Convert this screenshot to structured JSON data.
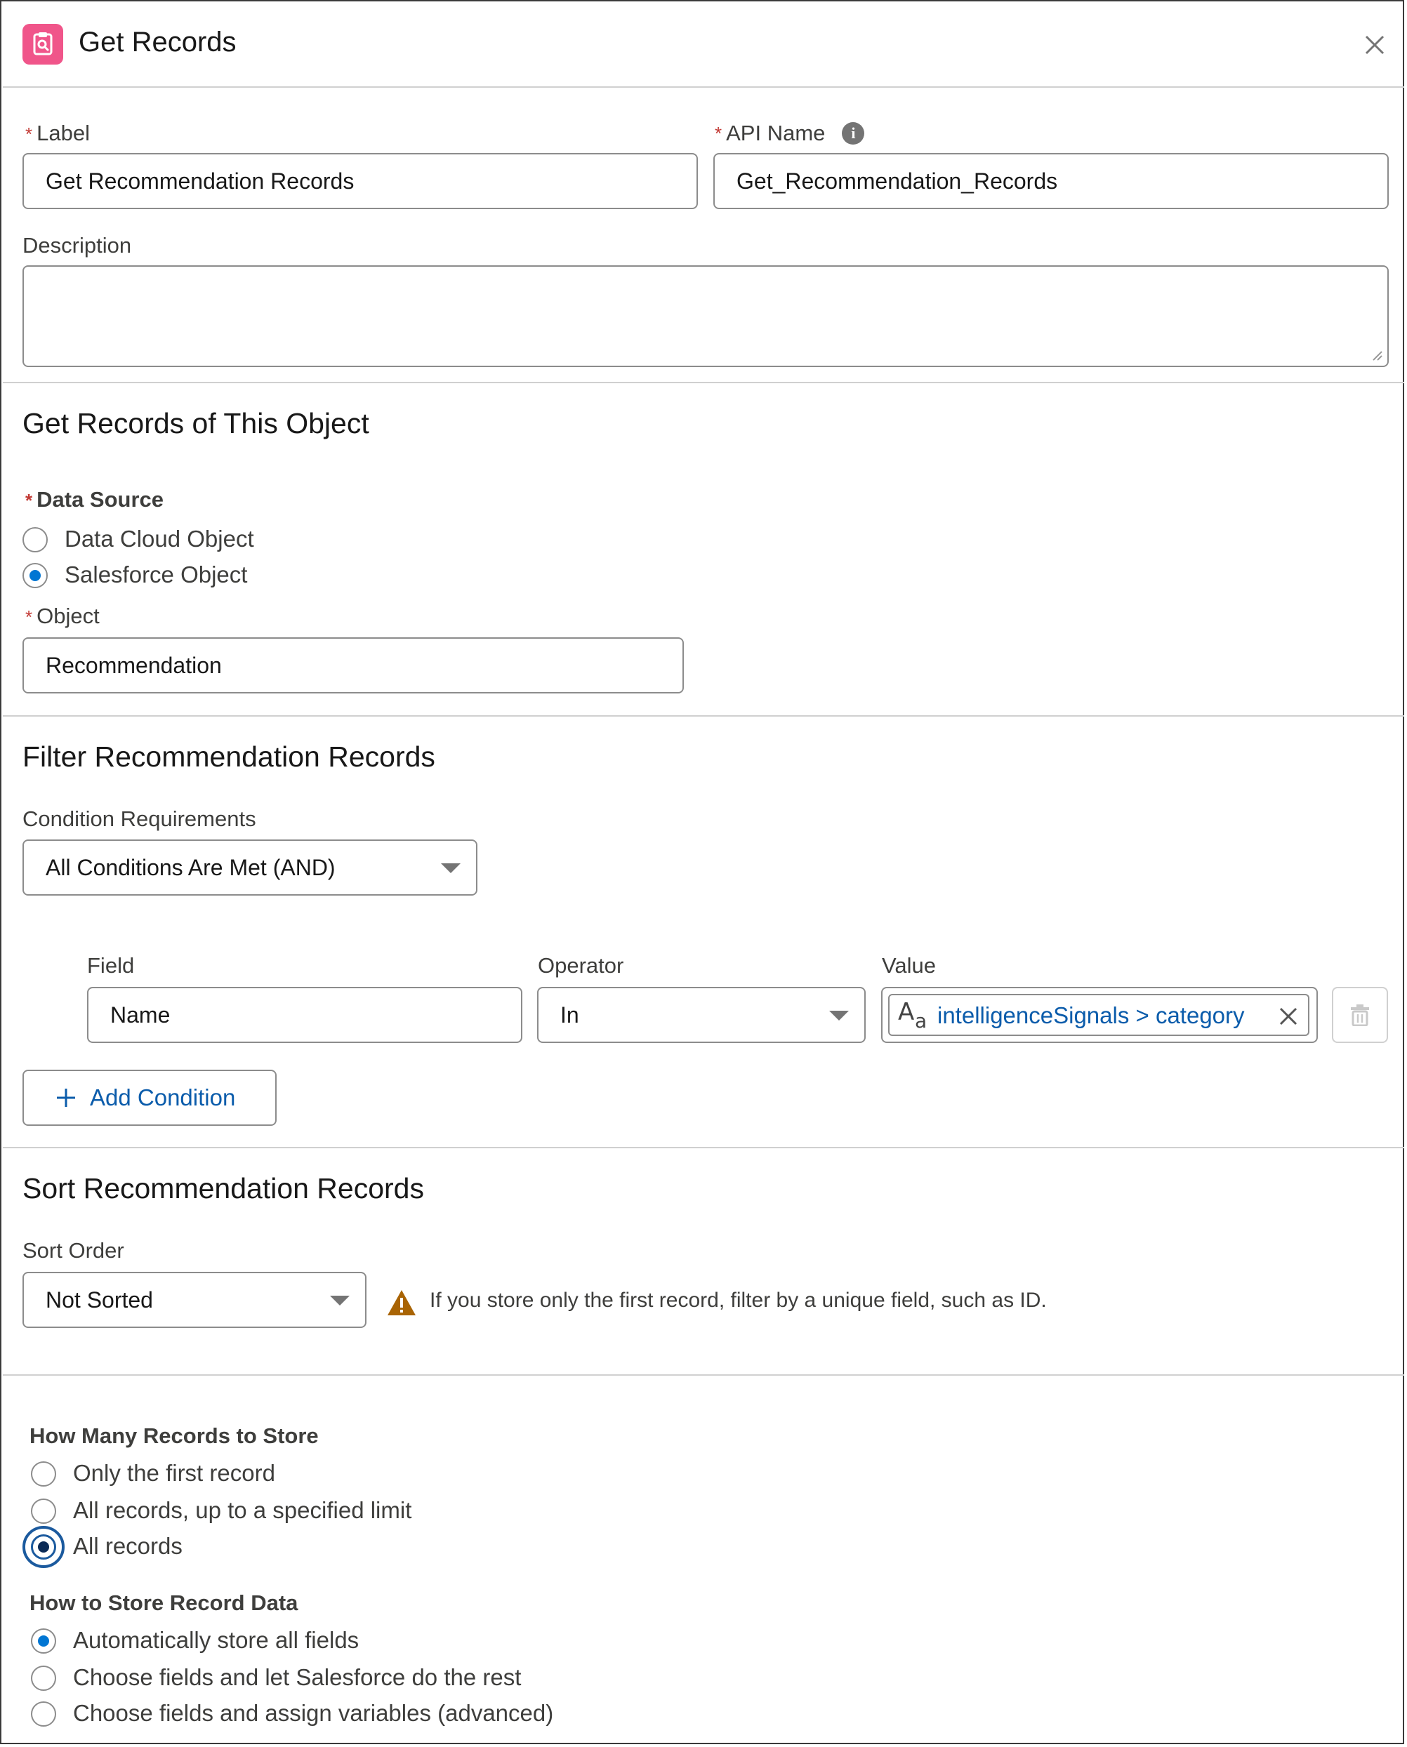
{
  "header": {
    "title": "Get Records",
    "icon": "get-records-icon",
    "close_icon": "close-icon"
  },
  "details": {
    "label": {
      "label": "Label",
      "value": "Get Recommendation Records"
    },
    "api_name": {
      "label": "API Name",
      "value": "Get_Recommendation_Records"
    },
    "description": {
      "label": "Description",
      "value": ""
    }
  },
  "object_section": {
    "title": "Get Records of This Object",
    "data_source_label": "Data Source",
    "data_source_options": [
      "Data Cloud Object",
      "Salesforce Object"
    ],
    "data_source_selected": "Salesforce Object",
    "object_label": "Object",
    "object_value": "Recommendation"
  },
  "filter_section": {
    "title": "Filter Recommendation Records",
    "condition_requirements_label": "Condition Requirements",
    "condition_requirements_value": "All Conditions Are Met (AND)",
    "condition": {
      "field_label": "Field",
      "field_value": "Name",
      "operator_label": "Operator",
      "operator_value": "In",
      "value_label": "Value",
      "value_resource": "intelligenceSignals > category",
      "value_type_glyph_big": "A",
      "value_type_glyph_small": "a"
    },
    "add_condition_label": "Add Condition"
  },
  "sort_section": {
    "title": "Sort Recommendation Records",
    "sort_order_label": "Sort Order",
    "sort_order_value": "Not Sorted",
    "warning": "If you store only the first record, filter by a unique field, such as ID."
  },
  "store_section": {
    "how_many_label": "How Many Records to Store",
    "how_many_options": [
      "Only the first record",
      "All records, up to a specified limit",
      "All records"
    ],
    "how_many_selected": "All records",
    "how_store_label": "How to Store Record Data",
    "how_store_options": [
      "Automatically store all fields",
      "Choose fields and let Salesforce do the rest",
      "Choose fields and assign variables (advanced)"
    ],
    "how_store_selected": "Automatically store all fields"
  },
  "colors": {
    "accent": "#0176d3",
    "brand_icon": "#f0558a",
    "required": "#c23934",
    "warning": "#a96404"
  }
}
